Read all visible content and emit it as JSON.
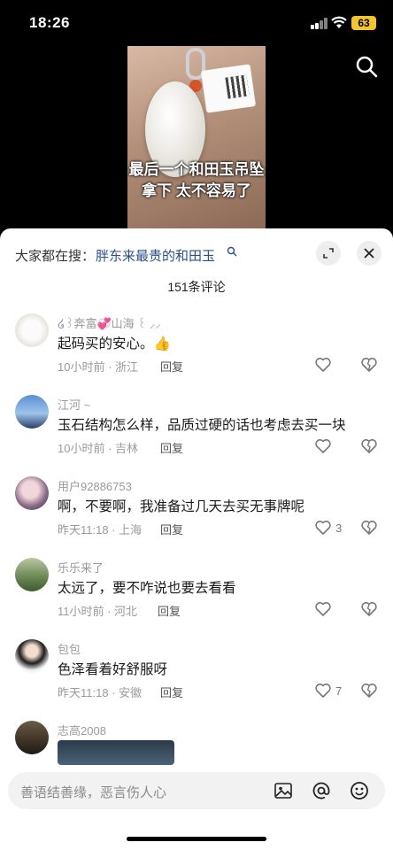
{
  "status_bar": {
    "time": "18:26",
    "battery": "63"
  },
  "video": {
    "caption": "最后一个和田玉吊坠拿下 太不容易了"
  },
  "sheet": {
    "search_prefix": "大家都在搜：",
    "search_term": "胖东来最贵的和田玉",
    "comment_count": "151条评论",
    "reply_label": "回复"
  },
  "comments": [
    {
      "user": "໒꒱奔富💞山海 ꒰ ⸝⸝",
      "text": "起码买的安心。👍",
      "meta": "10小时前 · 浙江",
      "likes": ""
    },
    {
      "user": "江河 ~",
      "text": "玉石结构怎么样，品质过硬的话也考虑去买一块",
      "meta": "10小时前 · 吉林",
      "likes": ""
    },
    {
      "user": "用户92886753",
      "text": "啊，不要啊，我准备过几天去买无事牌呢",
      "meta": "昨天11:18 · 上海",
      "likes": "3"
    },
    {
      "user": "乐乐来了",
      "text": "太远了，要不咋说也要去看看",
      "meta": "11小时前 · 河北",
      "likes": ""
    },
    {
      "user": "包包",
      "text": "色泽看着好舒服呀",
      "meta": "昨天11:18 · 安徽",
      "likes": "7"
    },
    {
      "user": "志高2008",
      "text": "",
      "meta": "",
      "likes": ""
    }
  ],
  "input_bar": {
    "placeholder": "善语结善缘，恶言伤人心"
  }
}
